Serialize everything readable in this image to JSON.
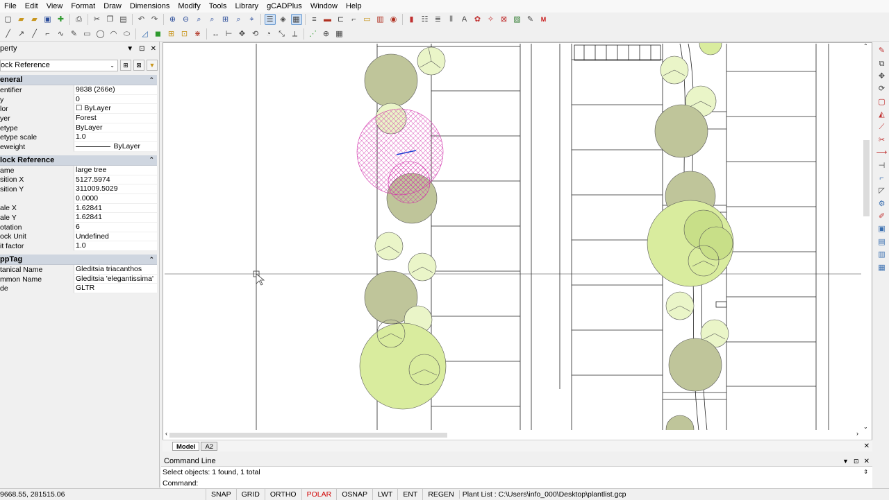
{
  "menu": [
    "File",
    "Edit",
    "View",
    "Format",
    "Draw",
    "Dimensions",
    "Modify",
    "Tools",
    "Library",
    "gCADPlus",
    "Window",
    "Help"
  ],
  "property_panel": {
    "title": "perty",
    "selected_type": "ock Reference",
    "sections": [
      {
        "name": "eneral",
        "rows": [
          {
            "k": "entifier",
            "v": "9838 (266e)"
          },
          {
            "k": "y",
            "v": "0"
          },
          {
            "k": "lor",
            "v": "☐ ByLayer"
          },
          {
            "k": "yer",
            "v": "Forest"
          },
          {
            "k": "etype",
            "v": "ByLayer"
          },
          {
            "k": "etype scale",
            "v": "1.0"
          },
          {
            "k": "eweight",
            "v": "ByLayer"
          }
        ]
      },
      {
        "name": "lock Reference",
        "rows": [
          {
            "k": "ame",
            "v": "large tree"
          },
          {
            "k": "sition X",
            "v": "5127.5974"
          },
          {
            "k": "sition Y",
            "v": "311009.5029"
          },
          {
            "k": "",
            "v": "0.0000"
          },
          {
            "k": "ale X",
            "v": "1.62841"
          },
          {
            "k": "ale Y",
            "v": "1.62841"
          },
          {
            "k": "otation",
            "v": "6"
          },
          {
            "k": "ock Unit",
            "v": "Undefined"
          },
          {
            "k": "it factor",
            "v": "1.0"
          }
        ]
      },
      {
        "name": "ppTag",
        "rows": [
          {
            "k": "tanical Name",
            "v": "Gleditsia triacanthos"
          },
          {
            "k": "mmon Name",
            "v": "Gleditsia 'elegantissima'"
          },
          {
            "k": "de",
            "v": "GLTR"
          }
        ]
      }
    ]
  },
  "layout_tabs": [
    "Model",
    "A2"
  ],
  "command": {
    "title": "Command Line",
    "history": "Select objects: 1 found,  1 total",
    "prompt": "Command:"
  },
  "status": {
    "coords": "9668.55, 281515.06",
    "buttons": [
      {
        "label": "SNAP",
        "on": false
      },
      {
        "label": "GRID",
        "on": false
      },
      {
        "label": "ORTHO",
        "on": false
      },
      {
        "label": "POLAR",
        "on": true
      },
      {
        "label": "OSNAP",
        "on": false
      },
      {
        "label": "LWT",
        "on": false
      },
      {
        "label": "ENT",
        "on": false
      },
      {
        "label": "REGEN",
        "on": false
      }
    ],
    "plant_list": "Plant List : C:\\Users\\info_000\\Desktop\\plantlist.gcp"
  },
  "colors": {
    "tree_olive": "#bfc59a",
    "tree_light": "#d9ec9e",
    "tree_pale": "#eaf5c8",
    "hatch_magenta": "#d02aa8",
    "polar_on": "#d00000"
  }
}
